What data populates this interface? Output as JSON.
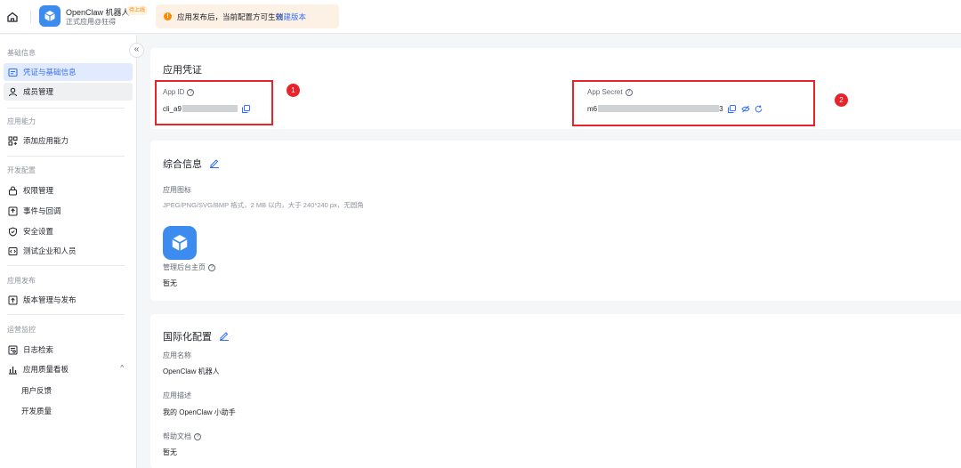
{
  "topbar": {
    "app_name": "OpenClaw 机器人",
    "badge": "待上线",
    "app_subtitle": "正式应用@狂得",
    "notice_text": "应用发布后，当前配置方可生效",
    "notice_link": "创建版本"
  },
  "sidebar": {
    "collapse": "«",
    "sections": {
      "basic": "基础信息",
      "capability": "应用能力",
      "dev": "开发配置",
      "release": "应用发布",
      "ops": "运营监控"
    },
    "items": {
      "credentials": "凭证与基础信息",
      "members": "成员管理",
      "add_capability": "添加应用能力",
      "permissions": "权限管理",
      "events": "事件与回调",
      "security": "安全设置",
      "test_org": "测试企业和人员",
      "versions": "版本管理与发布",
      "logs": "日志检索",
      "quality": "应用质量看板",
      "feedback": "用户反馈",
      "dev_quality": "开发质量"
    }
  },
  "credentials": {
    "title": "应用凭证",
    "app_id_label": "App ID",
    "app_id_value": "cli_a9",
    "app_secret_label": "App Secret",
    "app_secret_prefix": "m6",
    "app_secret_suffix": "3",
    "annotation_1": "1",
    "annotation_2": "2"
  },
  "general": {
    "title": "综合信息",
    "icon_label": "应用图标",
    "icon_hint": "JPEG/PNG/SVG/BMP 格式，2 MB 以内，大于 240*240 px，无圆角",
    "admin_home_label": "管理后台主页",
    "admin_home_value": "暂无"
  },
  "i18n": {
    "title": "国际化配置",
    "name_label": "应用名称",
    "name_value": "OpenClaw 机器人",
    "desc_label": "应用描述",
    "desc_value": "我的 OpenClaw 小助手",
    "help_label": "帮助文档",
    "help_value": "暂无"
  },
  "colors": {
    "accent": "#3370ff",
    "annotation_red": "#e8232a",
    "app_icon": "#3c8cf0",
    "notice_bg": "#fdf1e5"
  },
  "icons": [
    "home-icon",
    "cube-icon",
    "warning-icon",
    "copy-icon",
    "eye-off-icon",
    "refresh-icon",
    "edit-icon",
    "help-icon"
  ]
}
